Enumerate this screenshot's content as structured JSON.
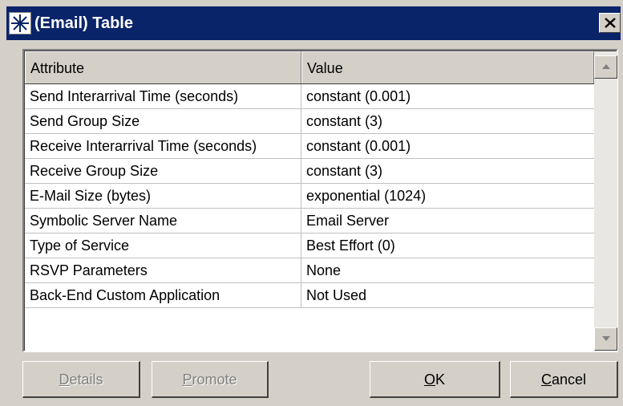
{
  "window": {
    "title": "(Email) Table",
    "close_glyph": "✕"
  },
  "table": {
    "columns": [
      "Attribute",
      "Value"
    ],
    "rows": [
      {
        "attribute": "Send Interarrival Time (seconds)",
        "value": "constant (0.001)"
      },
      {
        "attribute": "Send Group Size",
        "value": "constant (3)"
      },
      {
        "attribute": "Receive Interarrival Time (seconds)",
        "value": "constant (0.001)"
      },
      {
        "attribute": "Receive Group Size",
        "value": "constant (3)"
      },
      {
        "attribute": "E-Mail Size (bytes)",
        "value": "exponential (1024)"
      },
      {
        "attribute": "Symbolic Server Name",
        "value": "Email Server"
      },
      {
        "attribute": "Type of Service",
        "value": "Best Effort (0)"
      },
      {
        "attribute": "RSVP Parameters",
        "value": "None"
      },
      {
        "attribute": "Back-End Custom Application",
        "value": "Not Used"
      }
    ]
  },
  "buttons": {
    "details": {
      "first": "D",
      "rest": "etails"
    },
    "promote": {
      "first": "P",
      "rest": "romote"
    },
    "ok": {
      "first": "O",
      "rest": "K"
    },
    "cancel": {
      "first": "C",
      "rest": "ancel"
    }
  },
  "colors": {
    "titlebar": "#0a246a",
    "face": "#d4d0c8"
  },
  "icons": {
    "app": "star-burst-icon",
    "close": "close-icon",
    "scroll_up": "arrow-up-icon",
    "scroll_down": "arrow-down-icon"
  }
}
